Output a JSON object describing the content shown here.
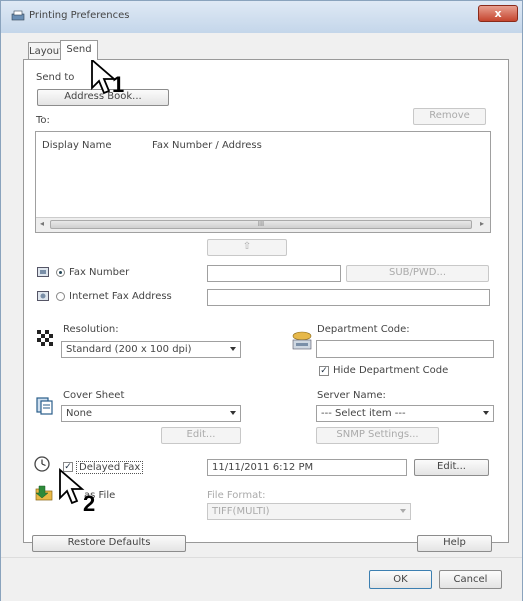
{
  "window": {
    "title": "Printing Preferences",
    "close_label": "x"
  },
  "tabs": [
    {
      "label": "Layout"
    },
    {
      "label": "Send"
    }
  ],
  "send": {
    "send_to_label": "Send to",
    "address_book_label": "Address Book...",
    "to_label": "To:",
    "remove_label": "Remove",
    "columns": [
      "Display Name",
      "Fax Number / Address"
    ],
    "scroll_thumb": "III",
    "add_arrow": "⇧",
    "fax_number_label": "Fax Number",
    "sub_pwd_label": "SUB/PWD...",
    "internet_fax_label": "Internet Fax Address"
  },
  "resolution": {
    "label": "Resolution:",
    "value": "Standard (200 x 100 dpi)"
  },
  "department": {
    "label": "Department Code:",
    "hide_label": "Hide Department Code",
    "hide_checked": true
  },
  "cover": {
    "label": "Cover Sheet",
    "value": "None",
    "edit_label": "Edit..."
  },
  "server": {
    "label": "Server Name:",
    "value": "--- Select item ---",
    "snmp_label": "SNMP Settings..."
  },
  "delayed": {
    "label": "Delayed Fax",
    "checked": true,
    "datetime": "11/11/2011 6:12 PM",
    "edit_label": "Edit..."
  },
  "save_file": {
    "label": "as File",
    "format_label": "File Format:",
    "format_value": "TIFF(MULTI)"
  },
  "annotations": {
    "step1": "1",
    "step2": "2"
  },
  "footer": {
    "restore_label": "Restore Defaults",
    "help_label": "Help",
    "ok_label": "OK",
    "cancel_label": "Cancel"
  }
}
